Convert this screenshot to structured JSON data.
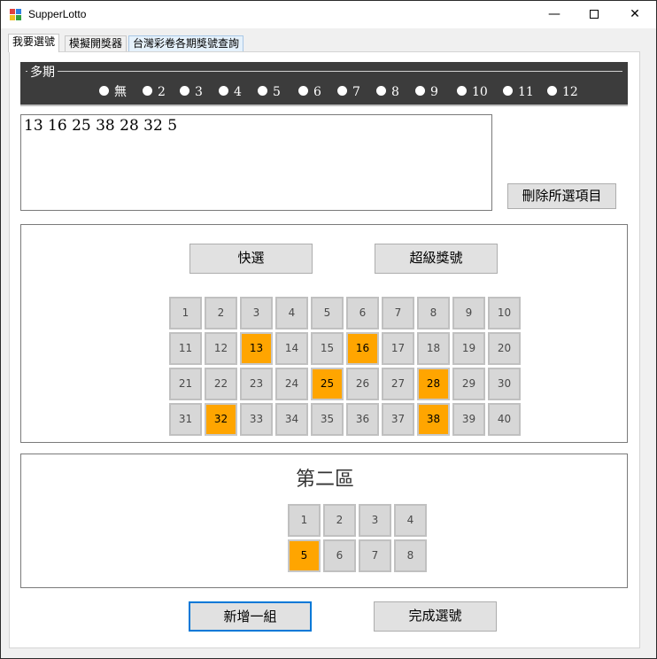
{
  "window": {
    "title": "SupperLotto",
    "minimize": "—",
    "close": "✕"
  },
  "tabs": [
    {
      "label": "我要選號",
      "active": true
    },
    {
      "label": "模擬開獎器",
      "active": false
    },
    {
      "label": "台灣彩卷各期獎號查詢",
      "active": false
    }
  ],
  "multi_period": {
    "title": "多期",
    "options": [
      "無",
      "2",
      "3",
      "4",
      "5",
      "6",
      "7",
      "8",
      "9",
      "10",
      "11",
      "12"
    ]
  },
  "selection_text": "13  16  25  38  28  32  5",
  "buttons": {
    "delete_selected": "刪除所選項目",
    "quick_pick": "快選",
    "super_number": "超級獎號",
    "add_group": "新增一組",
    "finish": "完成選號"
  },
  "zone1": {
    "numbers": [
      1,
      2,
      3,
      4,
      5,
      6,
      7,
      8,
      9,
      10,
      11,
      12,
      13,
      14,
      15,
      16,
      17,
      18,
      19,
      20,
      21,
      22,
      23,
      24,
      25,
      26,
      27,
      28,
      29,
      30,
      31,
      32,
      33,
      34,
      35,
      36,
      37,
      38,
      39,
      40
    ],
    "selected": [
      13,
      16,
      25,
      28,
      32,
      38
    ]
  },
  "zone2": {
    "title": "第二區",
    "numbers": [
      1,
      2,
      3,
      4,
      5,
      6,
      7,
      8
    ],
    "selected": [
      5
    ]
  },
  "colors": {
    "selected": "#ffa500",
    "unselected": "#d7d7d7",
    "group_bg": "#3c3c3c",
    "focus_border": "#0078d7"
  }
}
